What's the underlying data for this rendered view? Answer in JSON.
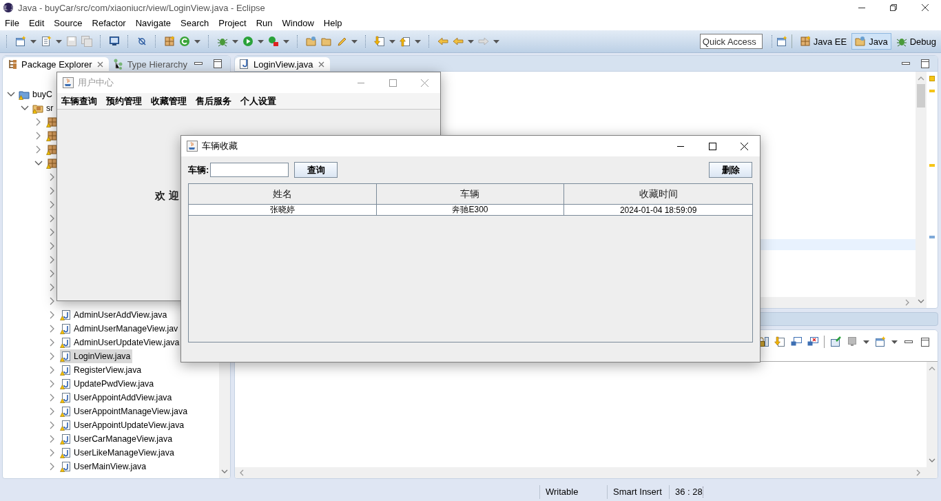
{
  "window": {
    "title": "Java - buyCar/src/com/xiaoniucr/view/LoginView.java - Eclipse"
  },
  "menu": [
    "File",
    "Edit",
    "Source",
    "Refactor",
    "Navigate",
    "Search",
    "Project",
    "Run",
    "Window",
    "Help"
  ],
  "toolbar": {
    "quick_access": {
      "placeholder": "Quick Access"
    },
    "perspectives": [
      {
        "label": "Java EE",
        "selected": false
      },
      {
        "label": "Java",
        "selected": true
      },
      {
        "label": "Debug",
        "selected": false
      }
    ]
  },
  "package_explorer": {
    "tabs": [
      {
        "label": "Package Explorer",
        "selected": true
      },
      {
        "label": "Type Hierarchy",
        "selected": false
      }
    ],
    "tree": [
      {
        "kind": "project",
        "label": "buyC",
        "expanded": true,
        "selected": false,
        "children": [
          {
            "kind": "folder",
            "label": "sr",
            "expanded": true,
            "selected": false,
            "children": [
              {
                "kind": "package",
                "expanded": false
              },
              {
                "kind": "package",
                "expanded": false
              },
              {
                "kind": "package",
                "expanded": false
              },
              {
                "kind": "package",
                "expanded": true,
                "children": [
                  {
                    "kind": "file",
                    "expanded": false
                  },
                  {
                    "kind": "file",
                    "expanded": false
                  },
                  {
                    "kind": "file",
                    "expanded": false
                  },
                  {
                    "kind": "file",
                    "expanded": false
                  },
                  {
                    "kind": "file",
                    "expanded": false
                  },
                  {
                    "kind": "file",
                    "expanded": false
                  },
                  {
                    "kind": "file",
                    "expanded": false
                  },
                  {
                    "kind": "file",
                    "expanded": false
                  },
                  {
                    "kind": "file",
                    "expanded": false
                  },
                  {
                    "kind": "file",
                    "expanded": false
                  },
                  {
                    "kind": "file",
                    "label": "AdminUserAddView.java",
                    "expanded": false,
                    "selected": false
                  },
                  {
                    "kind": "file",
                    "label": "AdminUserManageView.jav",
                    "expanded": false,
                    "selected": false
                  },
                  {
                    "kind": "file",
                    "label": "AdminUserUpdateView.java",
                    "expanded": false,
                    "selected": false
                  },
                  {
                    "kind": "file",
                    "label": "LoginView.java",
                    "expanded": false,
                    "selected": true
                  },
                  {
                    "kind": "file",
                    "label": "RegisterView.java",
                    "expanded": false,
                    "selected": false
                  },
                  {
                    "kind": "file",
                    "label": "UpdatePwdView.java",
                    "expanded": false,
                    "selected": false
                  },
                  {
                    "kind": "file",
                    "label": "UserAppointAddView.java",
                    "expanded": false,
                    "selected": false
                  },
                  {
                    "kind": "file",
                    "label": "UserAppointManageView.java",
                    "expanded": false,
                    "selected": false
                  },
                  {
                    "kind": "file",
                    "label": "UserAppointUpdateView.java",
                    "expanded": false,
                    "selected": false
                  },
                  {
                    "kind": "file",
                    "label": "UserCarManageView.java",
                    "expanded": false,
                    "selected": false
                  },
                  {
                    "kind": "file",
                    "label": "UserLikeManageView.java",
                    "expanded": false,
                    "selected": false
                  },
                  {
                    "kind": "file",
                    "label": "UserMainView.java",
                    "expanded": false,
                    "selected": false
                  }
                ]
              }
            ]
          }
        ]
      }
    ]
  },
  "editor": {
    "tabs": [
      {
        "label": "LoginView.java",
        "selected": true
      }
    ]
  },
  "status_bar": [
    "Writable",
    "Smart Insert",
    "36 : 28"
  ],
  "user_center_window": {
    "title": "用户中心",
    "active": false,
    "menu": [
      "车辆查询",
      "预约管理",
      "收藏管理",
      "售后服务",
      "个人设置"
    ],
    "welcome": "欢迎"
  },
  "favorites_dialog": {
    "title": "车辆收藏",
    "active": true,
    "search_label": "车辆:",
    "search_button": "查询",
    "delete_button": "删除",
    "table": {
      "columns": [
        "姓名",
        "车辆",
        "收藏时间"
      ],
      "rows": [
        [
          "张晓婷",
          "奔驰E300",
          "2024-01-04 18:59:09"
        ]
      ]
    }
  }
}
